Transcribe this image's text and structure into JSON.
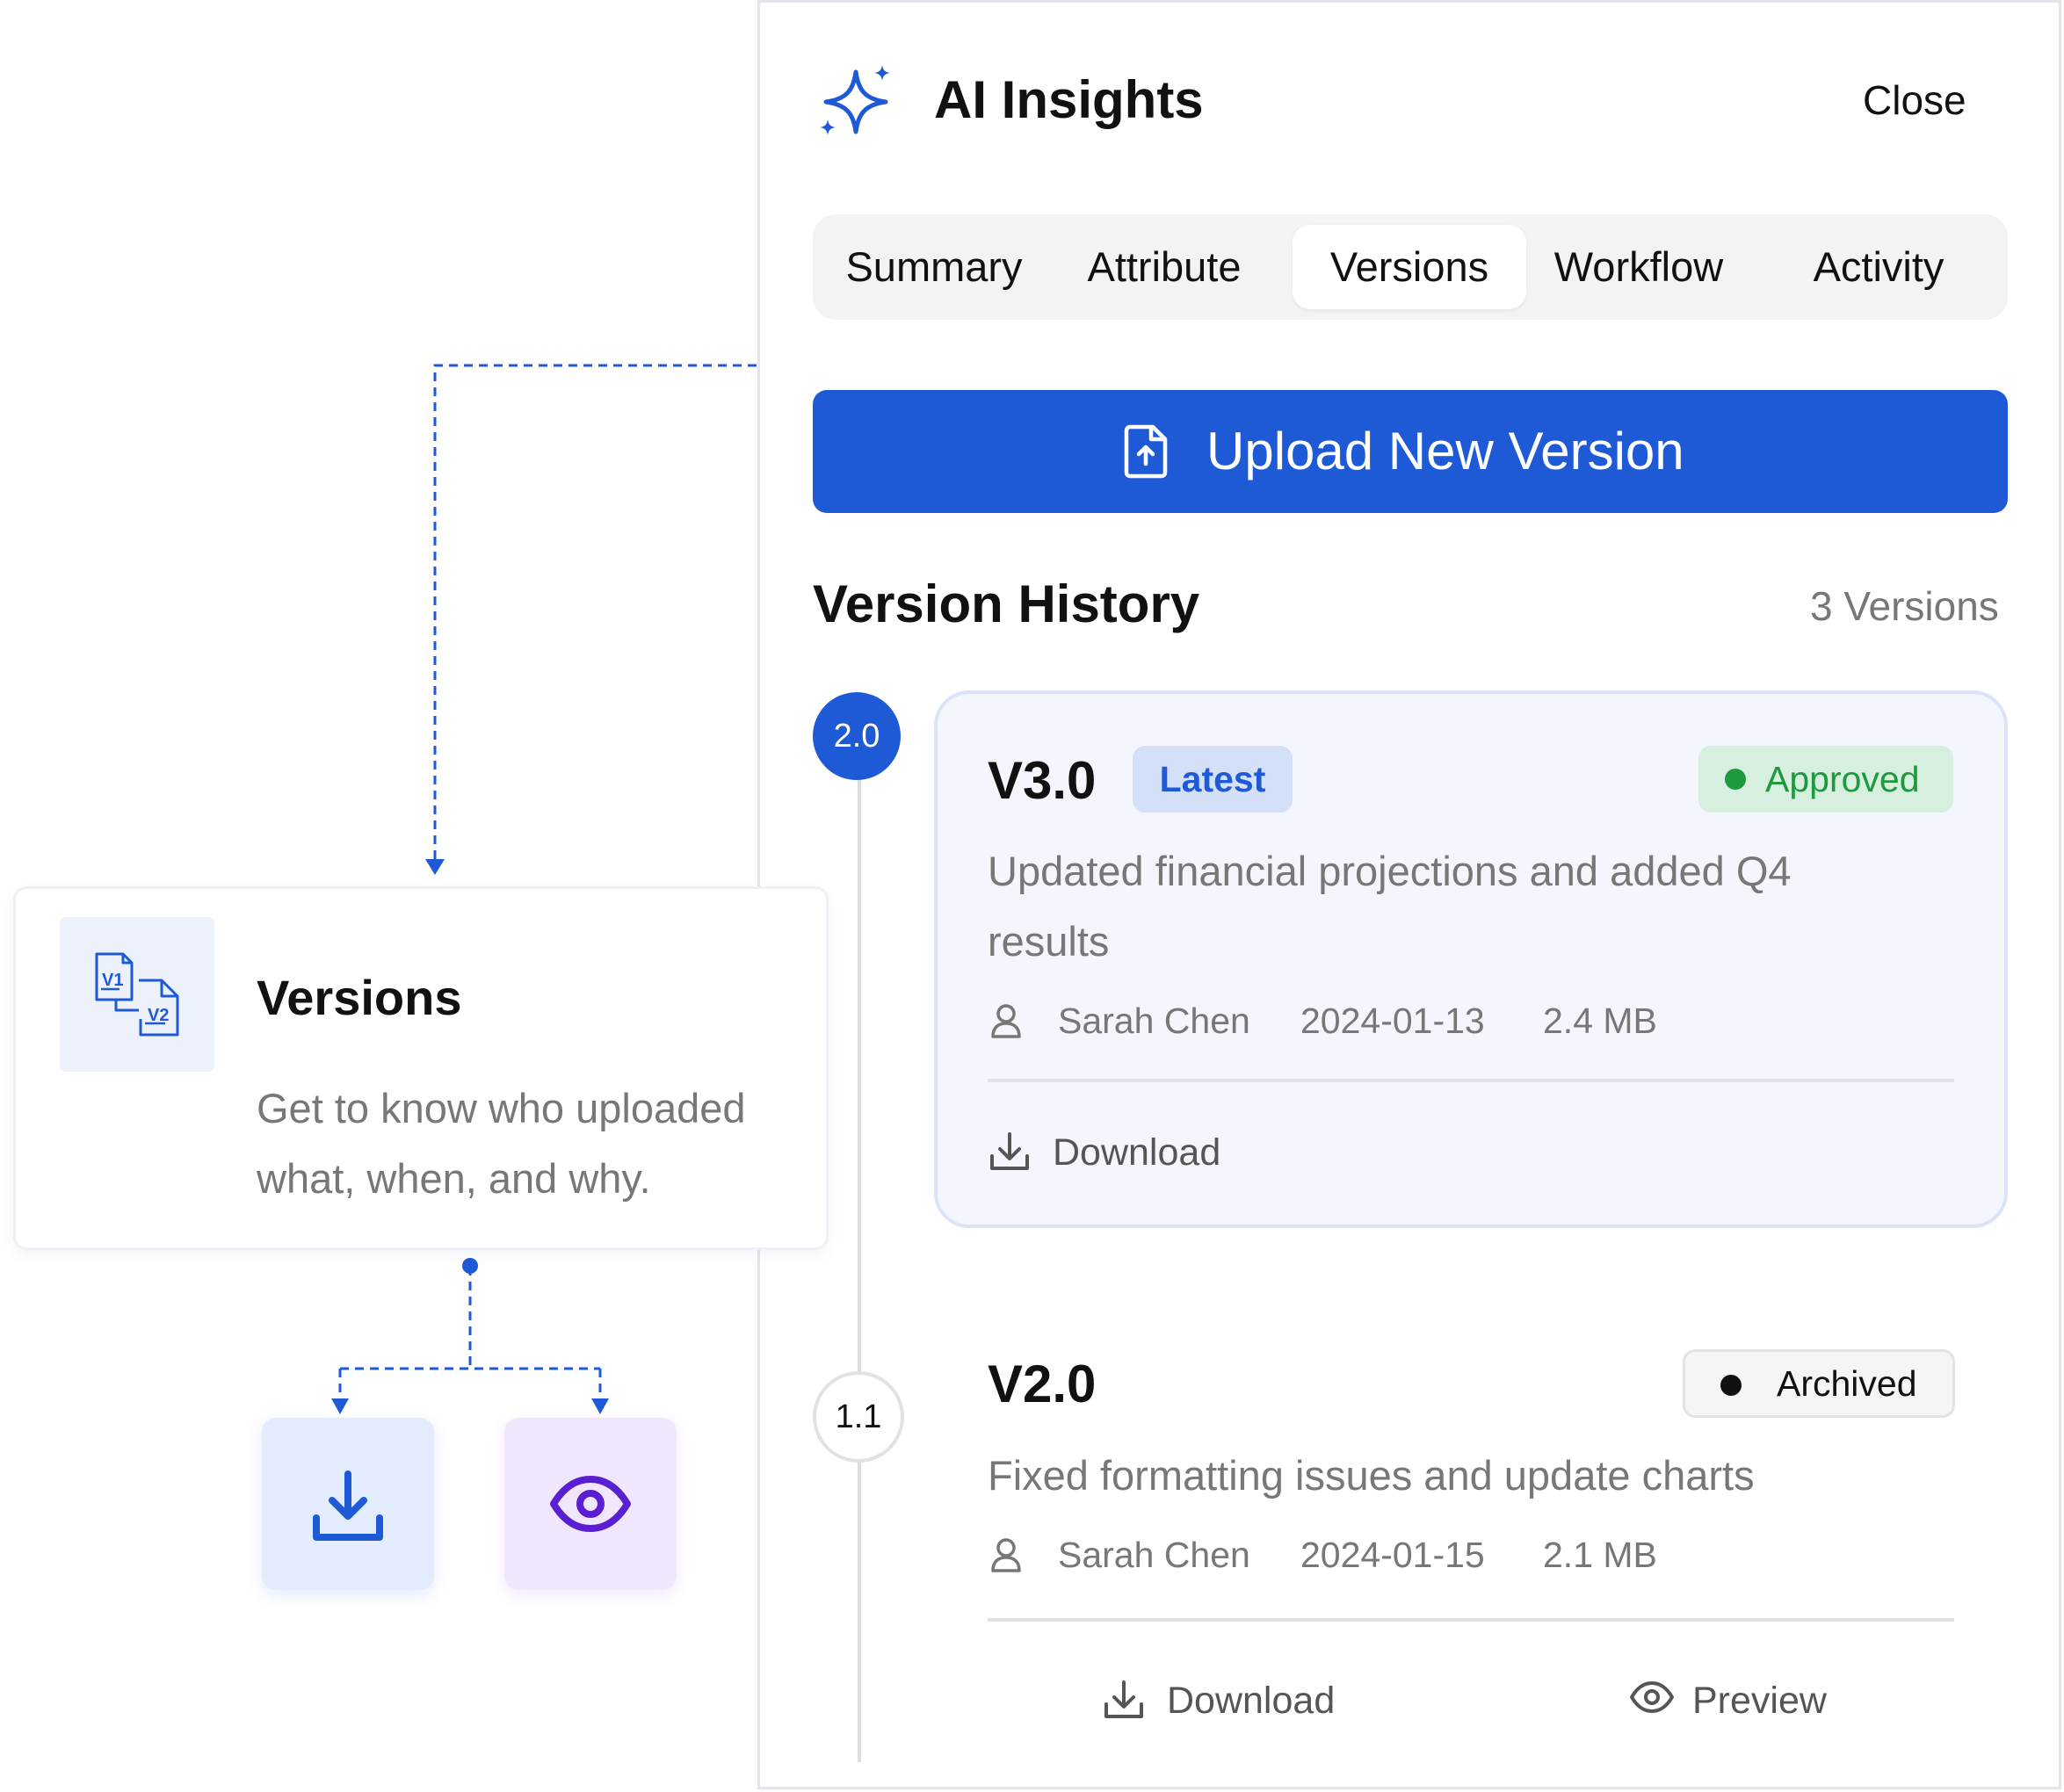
{
  "header": {
    "title": "AI Insights",
    "close_label": "Close",
    "icon": "sparkle-icon"
  },
  "tabs": [
    {
      "label": "Summary",
      "active": false
    },
    {
      "label": "Attribute",
      "active": false
    },
    {
      "label": "Versions",
      "active": true
    },
    {
      "label": "Workflow",
      "active": false
    },
    {
      "label": "Activity",
      "active": false
    }
  ],
  "upload": {
    "label": "Upload New Version",
    "icon": "file-upload-icon"
  },
  "version_history": {
    "title": "Version History",
    "count_label": "3 Versions"
  },
  "timeline": {
    "nodes": [
      "2.0",
      "1.1"
    ]
  },
  "versions": [
    {
      "title": "V3.0",
      "latest_label": "Latest",
      "status": "Approved",
      "description_line1": "Updated financial projections and added Q4",
      "description_line2": "results",
      "author": "Sarah Chen",
      "date": "2024-01-13",
      "size": "2.4 MB",
      "download_label": "Download"
    },
    {
      "title": "V2.0",
      "status": "Archived",
      "description": "Fixed formatting issues and update charts",
      "author": "Sarah Chen",
      "date": "2024-01-15",
      "size": "2.1 MB",
      "download_label": "Download",
      "preview_label": "Preview"
    }
  ],
  "callout": {
    "title": "Versions",
    "description_line1": "Get to know who uploaded",
    "description_line2": "what, when, and why.",
    "icon": "versions-files-icon",
    "icon_text_v1": "V1",
    "icon_text_v2": "V2"
  },
  "colors": {
    "accent": "#1f5ad6",
    "approved": "#1d9a3c",
    "preview_purple": "#5a1fd1"
  }
}
